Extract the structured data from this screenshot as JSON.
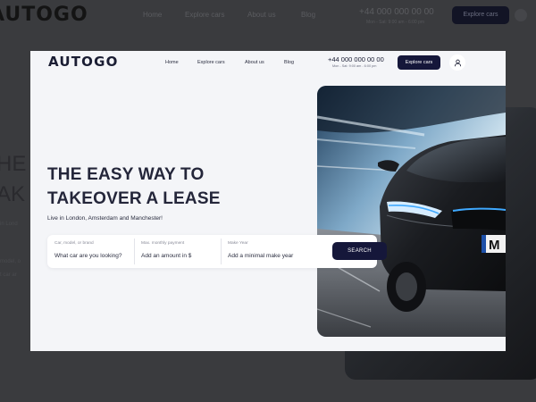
{
  "brand": {
    "logo": "AUTOGO"
  },
  "nav": [
    {
      "label": "Home"
    },
    {
      "label": "Explore cars"
    },
    {
      "label": "About us"
    },
    {
      "label": "Blog"
    }
  ],
  "contact": {
    "phone": "+44 000 000 00 00",
    "hours": "Mon - Sat: 9:00 am - 6:00 pm"
  },
  "header": {
    "cta_label": "Explore cars"
  },
  "hero": {
    "title_line1": "THE EASY WAY TO",
    "title_line2": "TAKEOVER A LEASE",
    "subtitle": "Live in London, Amsterdam and Manchester!"
  },
  "search": {
    "fields": [
      {
        "label": "Car, model, or brand",
        "placeholder": "What car are you looking?"
      },
      {
        "label": "Max. monthly payment",
        "placeholder": "Add an amount in $"
      },
      {
        "label": "Make Year",
        "placeholder": "Add a minimal make year"
      }
    ],
    "button_label": "SEARCH"
  },
  "background": {
    "hero_fragment1": "HE",
    "hero_fragment2": "AK",
    "text_fragment1": "in Lond",
    "text_fragment2": "model, o",
    "text_fragment3": "t car ar"
  },
  "colors": {
    "accent": "#15173a",
    "page_bg": "#f4f5f8",
    "headlight": "#3fa9ff",
    "car_body": "#1c1e22"
  },
  "icons": {
    "user": "user-icon",
    "car": "car-image"
  }
}
